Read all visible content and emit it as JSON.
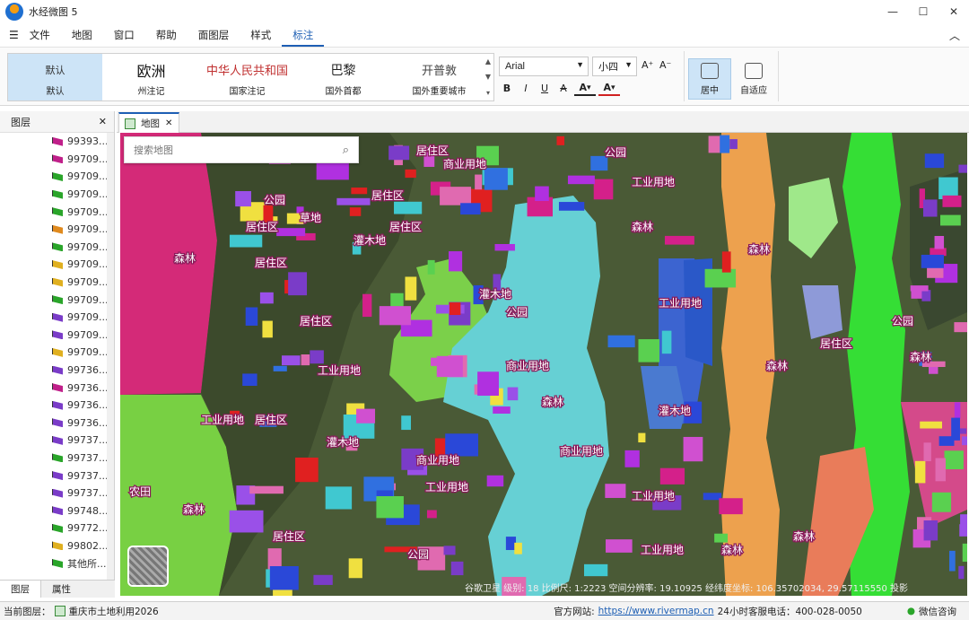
{
  "app": {
    "title": "水经微图 5"
  },
  "window": {
    "minimize": "—",
    "maximize": "☐",
    "close": "✕"
  },
  "menu": {
    "items": [
      "文件",
      "地图",
      "窗口",
      "帮助",
      "面图层",
      "样式",
      "标注"
    ],
    "active_index": 6
  },
  "ribbon": {
    "gallery": [
      {
        "preview": "默认",
        "caption": "默认"
      },
      {
        "preview": "欧洲",
        "caption": "州注记"
      },
      {
        "preview": "中华人民共和国",
        "caption": "国家注记"
      },
      {
        "preview": "巴黎",
        "caption": "国外首都"
      },
      {
        "preview": "开普敦",
        "caption": "国外重要城市"
      }
    ],
    "font_family": "Arial",
    "font_size": "小四",
    "grow_font": "A⁺",
    "shrink_font": "A⁻",
    "bold": "B",
    "italic": "I",
    "underline": "U",
    "strike": "A",
    "font_color": "A",
    "fill_color": "A",
    "center_label": "居中",
    "autofit_label": "自适应"
  },
  "layer_panel": {
    "title": "图层",
    "layers": [
      {
        "name": "99393...",
        "color": "#c0208a"
      },
      {
        "name": "99709...",
        "color": "#c0208a"
      },
      {
        "name": "99709...",
        "color": "#2aa52a"
      },
      {
        "name": "99709...",
        "color": "#2aa52a"
      },
      {
        "name": "99709...",
        "color": "#2aa52a"
      },
      {
        "name": "99709...",
        "color": "#e08a1e"
      },
      {
        "name": "99709...",
        "color": "#2aa52a"
      },
      {
        "name": "99709...",
        "color": "#e0b020"
      },
      {
        "name": "99709...",
        "color": "#e0b020"
      },
      {
        "name": "99709...",
        "color": "#2aa52a"
      },
      {
        "name": "99709...",
        "color": "#7a3cc8"
      },
      {
        "name": "99709...",
        "color": "#7a3cc8"
      },
      {
        "name": "99709...",
        "color": "#e0b020"
      },
      {
        "name": "99736...",
        "color": "#7a3cc8"
      },
      {
        "name": "99736...",
        "color": "#c0208a"
      },
      {
        "name": "99736...",
        "color": "#7a3cc8"
      },
      {
        "name": "99736...",
        "color": "#7a3cc8"
      },
      {
        "name": "99737...",
        "color": "#7a3cc8"
      },
      {
        "name": "99737...",
        "color": "#2aa52a"
      },
      {
        "name": "99737...",
        "color": "#7a3cc8"
      },
      {
        "name": "99737...",
        "color": "#7a3cc8"
      },
      {
        "name": "99748...",
        "color": "#7a3cc8"
      },
      {
        "name": "99772...",
        "color": "#2aa52a"
      },
      {
        "name": "99802...",
        "color": "#e0b020"
      },
      {
        "name": "其他所...",
        "color": "#2aa52a"
      }
    ],
    "tabs": [
      "图层",
      "属性"
    ]
  },
  "doc_tab": {
    "label": "地图"
  },
  "map": {
    "search_placeholder": "搜索地图",
    "status": "谷歌卫星  级别: 18  比例尺: 1:2223  空间分辨率: 19.10925  经纬度坐标: 106.35702034, 29.57115550  投影",
    "labels": [
      {
        "t": "居住区"
      },
      {
        "t": "商业用地"
      },
      {
        "t": "公园"
      },
      {
        "t": "居住区"
      },
      {
        "t": "草地"
      },
      {
        "t": "居住区"
      },
      {
        "t": "公园"
      },
      {
        "t": "工业用地"
      },
      {
        "t": "居住区"
      },
      {
        "t": "灌木地"
      },
      {
        "t": "森林"
      },
      {
        "t": "居住区"
      },
      {
        "t": "灌木地"
      },
      {
        "t": "公园"
      },
      {
        "t": "居住区"
      },
      {
        "t": "商业用地"
      },
      {
        "t": "工业用地"
      },
      {
        "t": "森林"
      },
      {
        "t": "森林"
      },
      {
        "t": "森林"
      },
      {
        "t": "商业用地"
      },
      {
        "t": "工业用地"
      },
      {
        "t": "森林"
      },
      {
        "t": "公园"
      },
      {
        "t": "居住区"
      },
      {
        "t": "工业用地"
      },
      {
        "t": "森林"
      },
      {
        "t": "灌木地"
      },
      {
        "t": "森林"
      },
      {
        "t": "公园"
      },
      {
        "t": "居住区"
      },
      {
        "t": "商业用地"
      },
      {
        "t": "工业用地"
      },
      {
        "t": "森林"
      },
      {
        "t": "农田"
      },
      {
        "t": "居住区"
      },
      {
        "t": "灌木地"
      },
      {
        "t": "工业用地"
      },
      {
        "t": "森林"
      },
      {
        "t": "工业用地"
      }
    ]
  },
  "statusbar": {
    "current_layer_label": "当前图层：",
    "current_layer": "重庆市土地利用2026",
    "website_label": "官方网站:",
    "website": "https://www.rivermap.cn",
    "hotline": "24小时客服电话：400-028-0050",
    "wechat": "微信咨询"
  }
}
